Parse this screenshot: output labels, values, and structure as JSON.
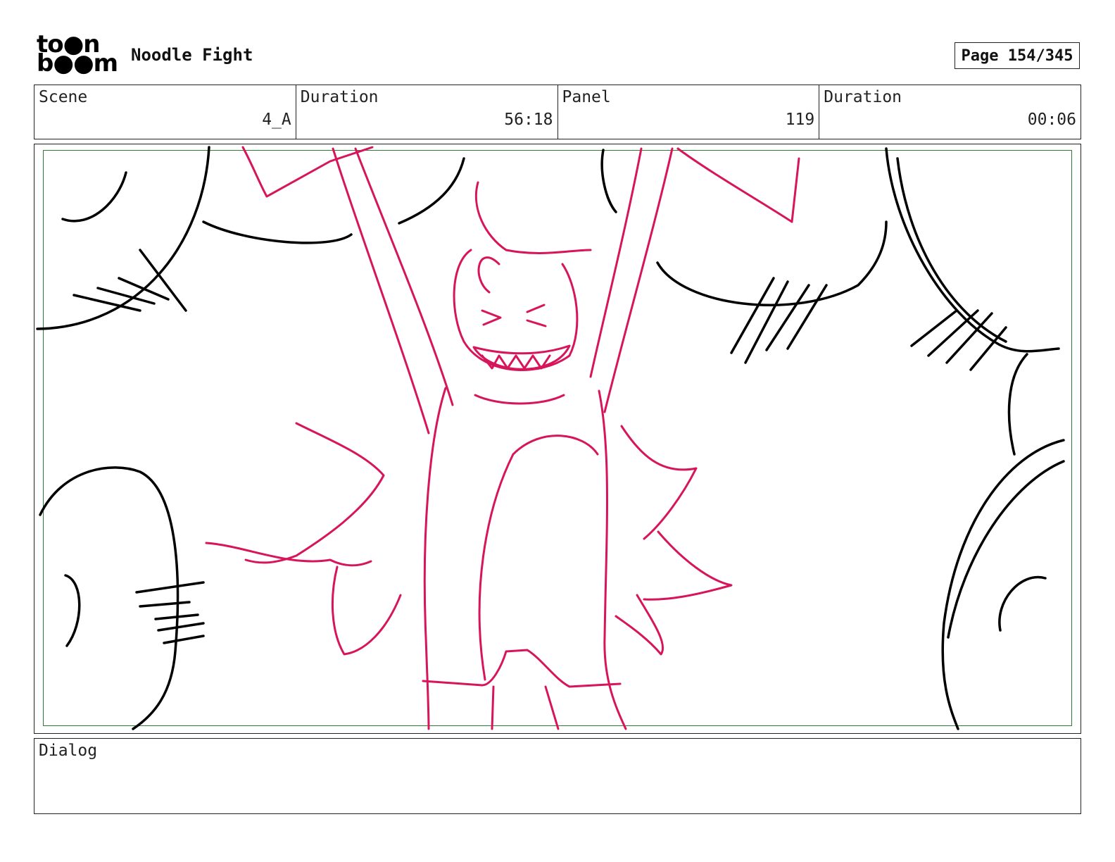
{
  "logo": {
    "text_line1": "to●n",
    "text_line2": "b●●m"
  },
  "header": {
    "project_title": "Noodle Fight",
    "page_label": "Page 154/345"
  },
  "info": {
    "scene_label": "Scene",
    "scene_value": "4_A",
    "duration_label": "Duration",
    "duration_value": "56:18",
    "panel_label": "Panel",
    "panel_value": "119",
    "panel_duration_label": "Duration",
    "panel_duration_value": "00:06"
  },
  "dialog": {
    "label": "Dialog",
    "text": ""
  },
  "colors": {
    "sketch_red": "#d6155a",
    "sketch_black": "#000000",
    "safe_frame": "#2e7d32"
  }
}
